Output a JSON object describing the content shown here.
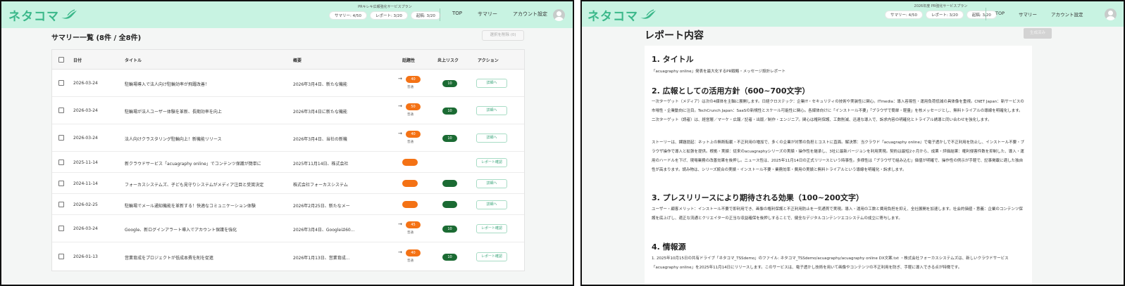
{
  "colors": {
    "header_bg": "#c8f3e2",
    "accent": "#3bb88a",
    "risk_high": "#f47215",
    "risk_low": "#1b6b33"
  },
  "header": {
    "logo_text": "ネタコマ",
    "logo_icon": "bird-swoosh-icon",
    "plan_name": "PRキレキ広報強化サービスプラン",
    "badges": [
      "サマリー: 4/50",
      "レポート: 3/20",
      "起稿: 3/20"
    ],
    "nav": [
      "TOP",
      "サマリー",
      "アカウント設定"
    ],
    "avatar_icon": "user-avatar-icon"
  },
  "right_header": {
    "plan_name": "2026年度 PR強化サービスプラン",
    "badges": [
      "サマリー: 4/50",
      "レポート: 3/20",
      "起稿: 3/20"
    ],
    "nav": [
      "TOP",
      "サマリー",
      "アカウント設定"
    ]
  },
  "summary": {
    "title": "サマリー一覧 (8件 / 全8件)",
    "bulk_delete": "選択を削除 (0)",
    "columns": [
      "日付",
      "タイトル",
      "概要",
      "話題性",
      "炎上リスク",
      "アクション"
    ],
    "rows": [
      {
        "date": "2026-03-24",
        "title": "駐輪場導入で法人向け駐輪効率が飛躍改善！",
        "summary": "2026年3月4日、新たな機能",
        "topic": "40",
        "topic_label": "普通",
        "risk": "10",
        "action": "詳細へ"
      },
      {
        "date": "2026-03-24",
        "title": "駐輪場が法人ユーザー体験を革新、長期効率を向上",
        "summary": "2026年3月4日に新たな機能",
        "topic": "50",
        "topic_label": "普通",
        "risk": "10",
        "action": "詳細へ"
      },
      {
        "date": "2026-03-24",
        "title": "法人向けクラスタリング駐輪向上！新機能リリース",
        "summary": "2026年3月4日、当社の新機",
        "topic": "40",
        "topic_label": "普通",
        "risk": "10",
        "action": "詳細へ"
      },
      {
        "date": "2025-11-14",
        "title": "新クラウドサービス「acuagraphy online」でコンテンツ保護が簡単に",
        "summary": "2025年11月14日、株式会社",
        "topic": "",
        "topic_label": "",
        "risk": "",
        "action": "レポート確認"
      },
      {
        "date": "2024-11-14",
        "title": "フォーカスシステムズ、子ども見守りシステムがメディア注目と受賞決定",
        "summary": "株式会社フォーカスシステム",
        "topic": "",
        "topic_label": "",
        "risk": "",
        "action": "詳細へ"
      },
      {
        "date": "2026-02-25",
        "title": "駐輪場でメール通知機能を革新する！快適なコミュニケーション体験",
        "summary": "2026年2月25日、新たなメー",
        "topic": "",
        "topic_label": "",
        "risk": "",
        "action": "詳細へ"
      },
      {
        "date": "2026-03-24",
        "title": "Google、新ログインアラート導入でアカウント保護を強化",
        "summary": "2026年3月4日、Googleは60...",
        "topic": "45",
        "topic_label": "普通",
        "risk": "10",
        "action": "レポート確認"
      },
      {
        "date": "2026-01-13",
        "title": "営業育成をプロジェクトが低成本費を削を促進",
        "summary": "2026年1月13日、営業育成...",
        "topic": "40",
        "topic_label": "普通",
        "risk": "10",
        "action": "レポート確認"
      }
    ]
  },
  "report": {
    "title": "レポート内容",
    "generate_btn": "生成済み",
    "sections": [
      {
        "heading": "1. タイトル",
        "body": "「acuagraphy online」発表を最大化するPR戦略・メッセージ設計レポート"
      },
      {
        "heading": "2. 広報としての活用方針（600~700文字）",
        "body": "一次ターゲット（メディア）は次の4媒体を主軸に展開します。日経クロステック：企業IT・セキュリティの技術や実装性に関心。ITmedia：導入容易性・運用負荷低減の具体像を重視。CNET Japan：新サービスの市場性・企業動向に注目。TechCrunch Japan：SaaSの新規性とスケール可能性に関心。各媒体向けに「インストール不要」「ブラウザで簡単・軽量」を核メッセージとし、無料トライアルの導線を明確化します。二次ターゲット（読者）は、経営層／マーケ・広報／記者・出版／制作・エンジニア。関心は権利保護、工数削減、迅速な導入で、訴求内容の明確化とトライアル誘導と同い合わせを強化します。"
      },
      {
        "heading": "",
        "body": "ストーリーは、課題提起：ネット上の無断転載・不正利用の増加で、多くの企業が対策の負担とコストに直面。解決策：当クラウド『acuagraphy online』で電子透かしで不正利用を防止し、インストール不要・ブラウザ操作で導入と拡張を提供。根拠・実績：従来のacuagraphyシリーズの実績・操作性を継承し、3社に最新バージョンを利用実現。契約は最短2ヶ月から、成果・評価結果：権利侵害件数を抑制した、導入・運用のハードルを下げ、現場業務の改善効果を後押し。ニュース性は、2025年11月14日の正式リリースという時事性。多様性は「ブラウザで組み込む」価値が明確で、操作性の例示が手軽で、記事掲載に適した独自性が高まります。読み物は、シリーズ統合の実績・インストール不要・業務効率・費用の実績と無料トライアルという導線を明確化・訴求します。"
      },
      {
        "heading": "3. プレスリリースにより期待される効果（100~200文字）",
        "body": "ユーザー・顧客メリット：インストール不要で即利用でき、画像の権利保護と不正利用防止を一気通貫で実現。導入・運用の工数と費用負担を抑え、全社展開を加速します。社会的価値・意義：企業のコンテンツ保護を底上げし、適正な流通とクリエイターの正当な収益確保を後押しすることで、健全なデジタルコンテンツエコシステムの成立に寄与します。"
      },
      {
        "heading": "4. 情報源",
        "body": "1. 2025年10月15日の共有ドライブ「ネタコマ_TSSdemo」のファイル: ネタコマ_TSSdemo/acuagraphy/acuagraphy online DX文案.txt ・株式会社フォーカスシステムズは、新しいクラウドサービス「acuagraphy online」を2025年11月14日にリリースします。このサービスは、電子透かし技術を用いて画像やコンテンツの不正利用を防ぎ、手軽に導入できる点が特徴です。"
      }
    ]
  }
}
